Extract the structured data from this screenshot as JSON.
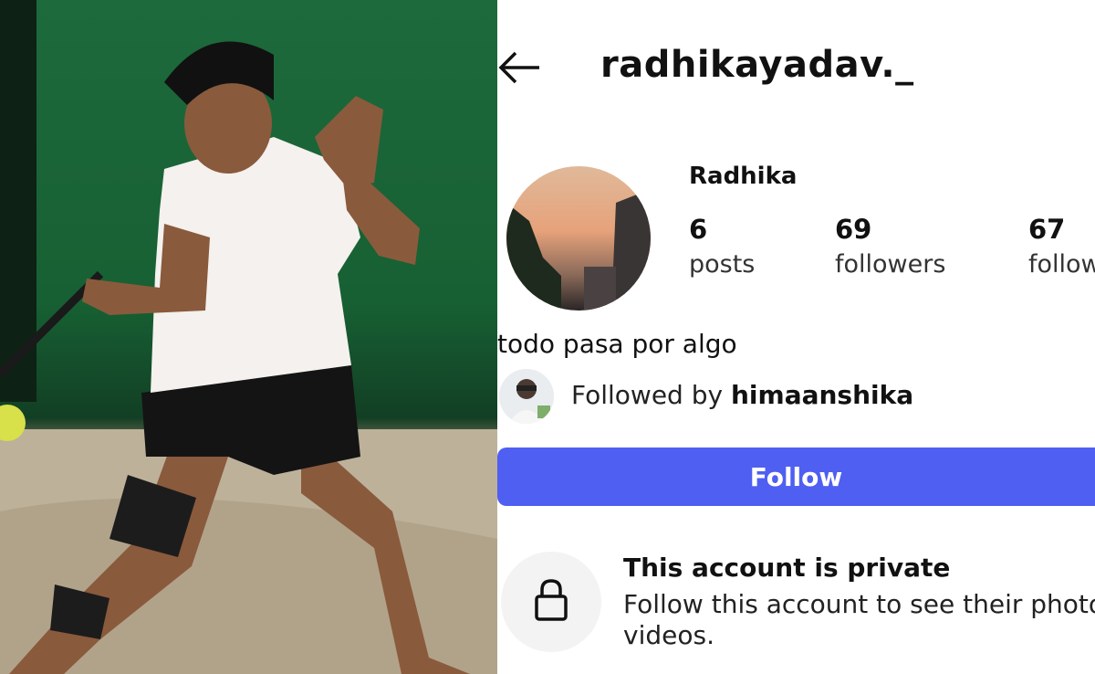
{
  "profile": {
    "username": "radhikayadav._",
    "display_name": "Radhika",
    "stats": [
      {
        "value": "6",
        "label": "posts"
      },
      {
        "value": "69",
        "label": "followers"
      },
      {
        "value": "67",
        "label": "follow"
      }
    ],
    "bio": "todo pasa por algo",
    "followed_by_prefix": "Followed by ",
    "followed_by_user": "himaanshika",
    "follow_button": "Follow",
    "private_title": "This account is private",
    "private_desc": "Follow this account to see their photo videos."
  },
  "colors": {
    "follow_button": "#4f5ff1",
    "court_green": "#1d6a3c",
    "lock_circle": "#f3f3f3"
  },
  "icons": {
    "back": "arrow-left-icon",
    "lock": "lock-icon"
  }
}
